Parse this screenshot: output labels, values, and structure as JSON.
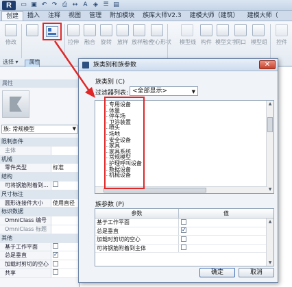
{
  "app": {
    "logo": "R"
  },
  "ribbon_tabs": [
    "创建",
    "插入",
    "注释",
    "视图",
    "管理",
    "附加模块",
    "族库大师V2.3",
    "建模大师（建筑）",
    "建模大师（"
  ],
  "ribbon": {
    "tools": [
      "修改",
      "拉伸",
      "融合",
      "旋转",
      "放样",
      "放样融合",
      "空心形状",
      "模型线",
      "构件",
      "模型文字",
      "洞口",
      "模型组",
      "控件"
    ],
    "footer": [
      "选择 ▾",
      "属性"
    ]
  },
  "properties": {
    "title": "属性",
    "type_selector": "族: 常规模型",
    "rows": [
      {
        "kind": "group",
        "label": "限制条件"
      },
      {
        "kind": "row",
        "label": "主体",
        "value": "",
        "dim": true
      },
      {
        "kind": "group",
        "label": "机械"
      },
      {
        "kind": "row",
        "label": "零件类型",
        "value": "标准"
      },
      {
        "kind": "group",
        "label": "结构"
      },
      {
        "kind": "row",
        "label": "可将钢筋附着到...",
        "check": false
      },
      {
        "kind": "group",
        "label": "尺寸标注"
      },
      {
        "kind": "row",
        "label": "圆形连接件大小",
        "value": "使用直径"
      },
      {
        "kind": "group",
        "label": "标识数据"
      },
      {
        "kind": "row",
        "label": "OmniClass 编号",
        "value": ""
      },
      {
        "kind": "row",
        "label": "OmniClass 标题",
        "value": "",
        "dim": true
      },
      {
        "kind": "group",
        "label": "其他"
      },
      {
        "kind": "row",
        "label": "基于工作平面",
        "check": false
      },
      {
        "kind": "row",
        "label": "总是垂直",
        "check": true
      },
      {
        "kind": "row",
        "label": "加载时剪切的空心",
        "check": false
      },
      {
        "kind": "row",
        "label": "共享",
        "check": false
      }
    ]
  },
  "dialog": {
    "title": "族类别和族参数",
    "close": "✕",
    "category_label": "族类别 (C)",
    "filter_label": "过滤器列表:",
    "filter_value": "<全部显示>",
    "categories": [
      "专用设备",
      "体量",
      "停车场",
      "卫浴装置",
      "喷头",
      "场地",
      "安全设备",
      "家具",
      "家具系统",
      "常规模型",
      "护理呼叫设备",
      "数据设备",
      "机械设备"
    ],
    "params_label": "族参数 (P)",
    "params_header": {
      "name": "参数",
      "value": "值"
    },
    "params": [
      {
        "name": "基于工作平面",
        "checked": false
      },
      {
        "name": "总是垂直",
        "checked": true
      },
      {
        "name": "加载时剪切的空心",
        "checked": false
      },
      {
        "name": "可将钢筋附着到主体",
        "checked": false
      }
    ],
    "ok_label": "确定",
    "cancel_label": "取消"
  },
  "annotation_color": "#e02727"
}
